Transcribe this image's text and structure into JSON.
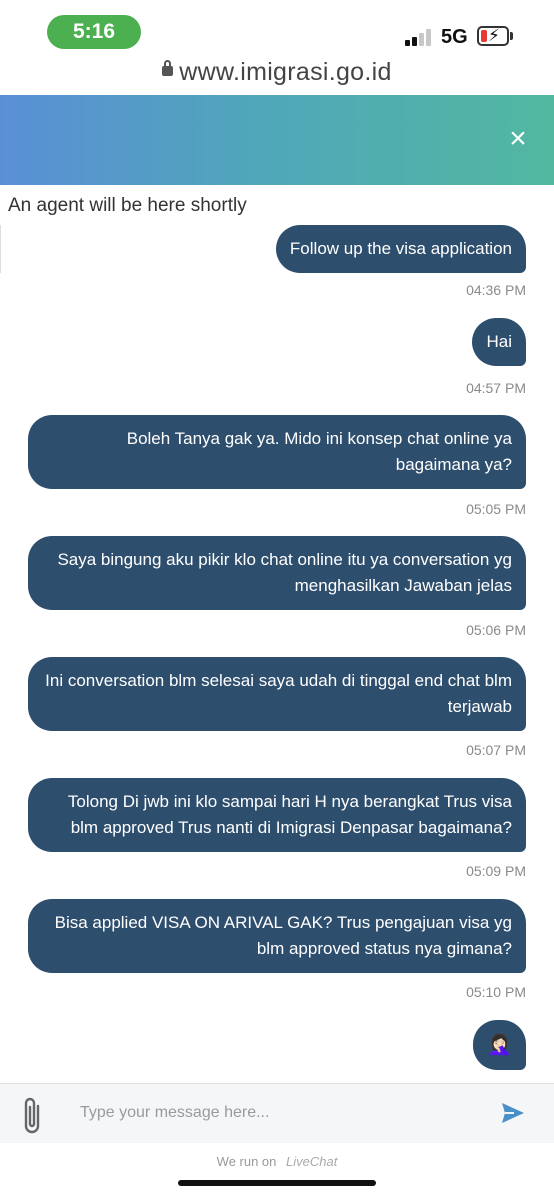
{
  "status_bar": {
    "time": "5:16",
    "network": "5G",
    "battery_color": "#e53935"
  },
  "browser": {
    "url": "www.imigrasi.go.id"
  },
  "chat": {
    "header_gradient": [
      "#5a8fd6",
      "#52b8a0"
    ],
    "close_label": "×",
    "agent_notice": "An agent will be here shortly",
    "bubble_color": "#2e4e6e",
    "messages": [
      {
        "text": "Follow up the visa application",
        "time": "04:36 PM"
      },
      {
        "text": "Hai",
        "time": "04:57 PM"
      },
      {
        "text": "Boleh Tanya gak ya. Mido ini konsep chat online ya bagaimana ya?",
        "time": "05:05 PM"
      },
      {
        "text": "Saya bingung aku pikir klo chat online itu ya conversation yg menghasilkan Jawaban jelas",
        "time": "05:06 PM"
      },
      {
        "text": "Ini conversation blm selesai saya udah di tinggal end chat blm terjawab",
        "time": "05:07 PM"
      },
      {
        "text": "Tolong Di jwb ini klo sampai hari H nya berangkat Trus visa blm approved Trus nanti di Imigrasi Denpasar bagaimana?",
        "time": "05:09 PM"
      },
      {
        "text": "Bisa applied VISA ON ARIVAL GAK? Trus pengajuan visa yg blm approved status nya gimana?",
        "time": "05:10 PM"
      },
      {
        "text": "🤦🏻‍♀️",
        "time": ""
      }
    ]
  },
  "composer": {
    "placeholder": "Type your message here...",
    "attach_icon": "paperclip-icon",
    "send_icon": "send-icon"
  },
  "footer": {
    "prefix": "We run on",
    "brand": "LiveChat"
  }
}
